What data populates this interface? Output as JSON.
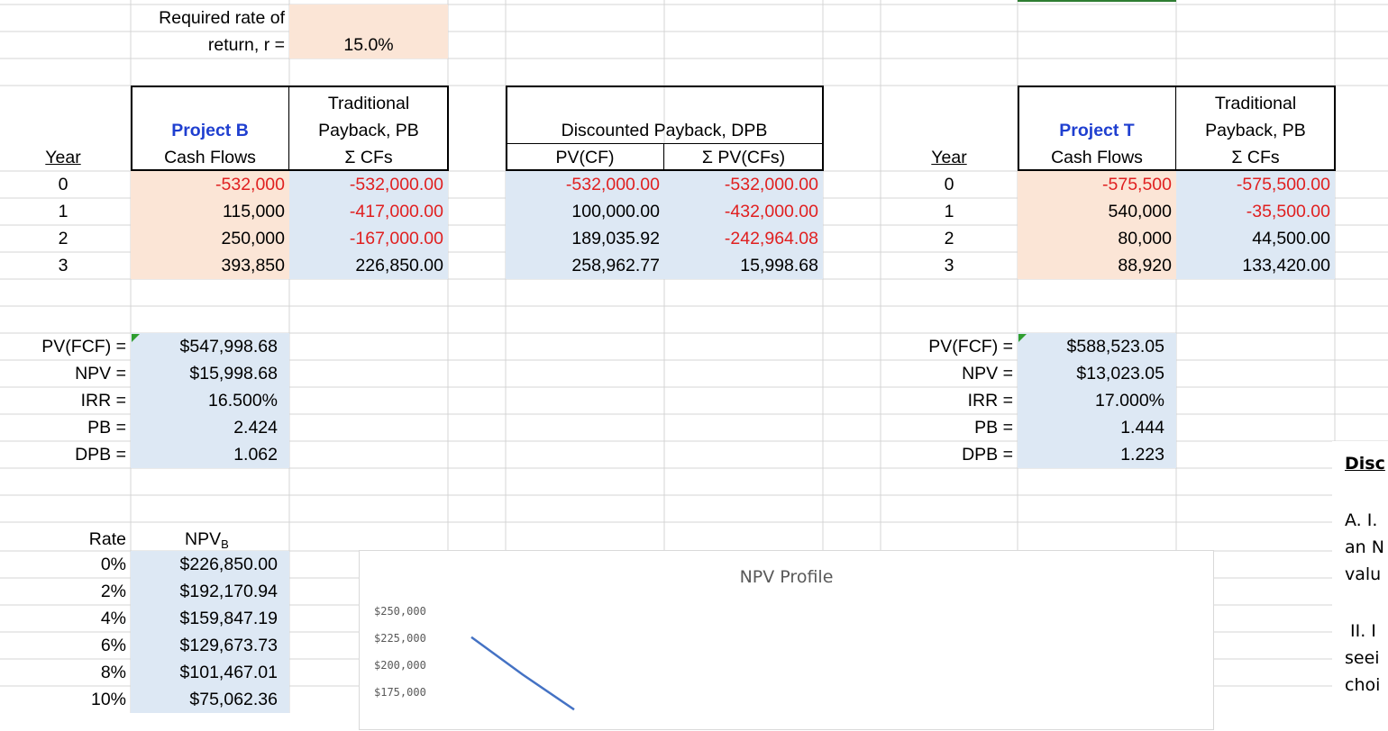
{
  "rate_cell": {
    "label_line1": "Required rate of",
    "label_line2": "return, r =",
    "value": "15.0%"
  },
  "project_b": {
    "title": "Project B",
    "cash_flows_header": "Cash Flows",
    "pb_header": [
      "Traditional",
      "Payback, PB",
      "Σ CFs"
    ],
    "dpb_header": [
      "Discounted Payback, DPB",
      "PV(CF)",
      "Σ PV(CFs)"
    ],
    "year_header": "Year",
    "rows": [
      {
        "year": "0",
        "cf": "-532,000",
        "cum_cf": "-532,000.00",
        "pv_cf": "-532,000.00",
        "cum_pv": "-532,000.00"
      },
      {
        "year": "1",
        "cf": "115,000",
        "cum_cf": "-417,000.00",
        "pv_cf": "100,000.00",
        "cum_pv": "-432,000.00"
      },
      {
        "year": "2",
        "cf": "250,000",
        "cum_cf": "-167,000.00",
        "pv_cf": "189,035.92",
        "cum_pv": "-242,964.08"
      },
      {
        "year": "3",
        "cf": "393,850",
        "cum_cf": "226,850.00",
        "pv_cf": "258,962.77",
        "cum_pv": "15,998.68"
      }
    ],
    "metrics": [
      {
        "label": "PV(FCF) =",
        "value": "$547,998.68"
      },
      {
        "label": "NPV =",
        "value": "$15,998.68"
      },
      {
        "label": "IRR =",
        "value": "16.500%"
      },
      {
        "label": "PB =",
        "value": "2.424"
      },
      {
        "label": "DPB =",
        "value": "1.062"
      }
    ]
  },
  "project_t": {
    "title": "Project T",
    "cash_flows_header": "Cash Flows",
    "pb_header": [
      "Traditional",
      "Payback, PB",
      "Σ CFs"
    ],
    "year_header": "Year",
    "rows": [
      {
        "year": "0",
        "cf": "-575,500",
        "cum_cf": "-575,500.00"
      },
      {
        "year": "1",
        "cf": "540,000",
        "cum_cf": "-35,500.00"
      },
      {
        "year": "2",
        "cf": "80,000",
        "cum_cf": "44,500.00"
      },
      {
        "year": "3",
        "cf": "88,920",
        "cum_cf": "133,420.00"
      }
    ],
    "metrics": [
      {
        "label": "PV(FCF) =",
        "value": "$588,523.05"
      },
      {
        "label": "NPV =",
        "value": "$13,023.05"
      },
      {
        "label": "IRR =",
        "value": "17.000%"
      },
      {
        "label": "PB =",
        "value": "1.444"
      },
      {
        "label": "DPB =",
        "value": "1.223"
      }
    ]
  },
  "npv_table": {
    "rate_header": "Rate",
    "npv_header": "NPV",
    "npv_sub": "B",
    "rows": [
      {
        "rate": "0%",
        "npv": "$226,850.00"
      },
      {
        "rate": "2%",
        "npv": "$192,170.94"
      },
      {
        "rate": "4%",
        "npv": "$159,847.19"
      },
      {
        "rate": "6%",
        "npv": "$129,673.73"
      },
      {
        "rate": "8%",
        "npv": "$101,467.01"
      },
      {
        "rate": "10%",
        "npv": "$75,062.36"
      }
    ]
  },
  "chart_data": {
    "type": "line",
    "title": "NPV Profile",
    "y_ticks": [
      "$250,000",
      "$225,000",
      "$200,000",
      "$175,000"
    ],
    "series": [
      {
        "color": "#4472c4",
        "x": [
          0,
          2,
          4
        ],
        "y": [
          226850,
          192170.94,
          159847.19
        ]
      }
    ],
    "ylim": [
      175000,
      250000
    ]
  },
  "notes": {
    "heading": "Disc",
    "lines": [
      "A. I.",
      "an N",
      "valu",
      "II. I",
      "seei",
      "choi"
    ]
  },
  "colors": {
    "input_fill": "#fbe5d6",
    "calc_fill": "#dde8f4",
    "negative": "#e02020",
    "project_title": "#1f3fd0",
    "chart_line": "#4472c4"
  }
}
